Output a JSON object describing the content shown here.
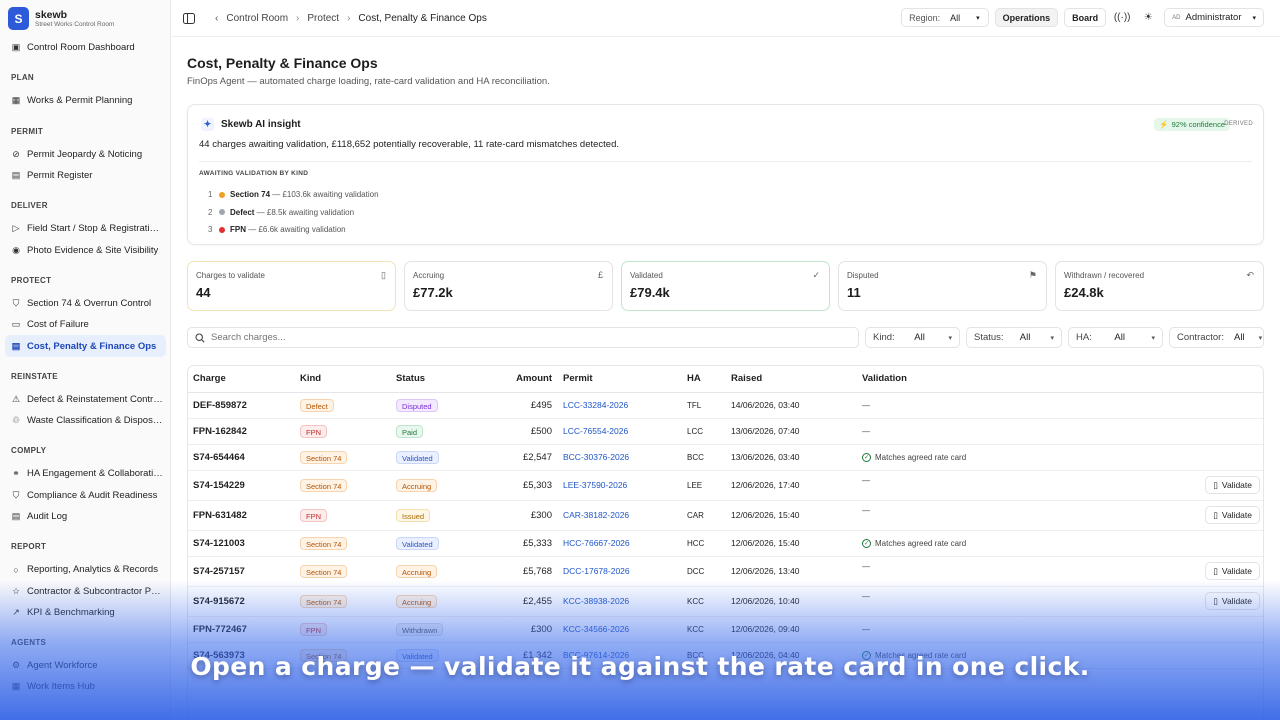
{
  "app": {
    "logo_letter": "S",
    "name": "skewb",
    "subtitle": "Street Works Control Room",
    "accent": "#2d5ad8"
  },
  "sidebar": {
    "top_item": {
      "label": "Control Room Dashboard",
      "icon": "dashboard-icon"
    },
    "sections": [
      {
        "title": "PLAN",
        "items": [
          {
            "label": "Works & Permit Planning",
            "icon": "calendar-icon"
          }
        ]
      },
      {
        "title": "PERMIT",
        "items": [
          {
            "label": "Permit Jeopardy & Noticing",
            "icon": "alert-icon"
          },
          {
            "label": "Permit Register",
            "icon": "register-icon"
          }
        ]
      },
      {
        "title": "DELIVER",
        "items": [
          {
            "label": "Field Start / Stop & Registrati…",
            "icon": "play-icon"
          },
          {
            "label": "Photo Evidence & Site Visibility",
            "icon": "camera-icon"
          }
        ]
      },
      {
        "title": "PROTECT",
        "items": [
          {
            "label": "Section 74 & Overrun Control",
            "icon": "shield-icon"
          },
          {
            "label": "Cost of Failure",
            "icon": "card-icon"
          },
          {
            "label": "Cost, Penalty & Finance Ops",
            "icon": "finance-icon",
            "active": true
          }
        ]
      },
      {
        "title": "REINSTATE",
        "items": [
          {
            "label": "Defect & Reinstatement Contr…",
            "icon": "defect-icon"
          },
          {
            "label": "Waste Classification & Dispos…",
            "icon": "waste-icon"
          }
        ]
      },
      {
        "title": "COMPLY",
        "items": [
          {
            "label": "HA Engagement & Collaborati…",
            "icon": "handshake-icon"
          },
          {
            "label": "Compliance & Audit Readiness",
            "icon": "check-shield-icon"
          },
          {
            "label": "Audit Log",
            "icon": "log-icon"
          }
        ]
      },
      {
        "title": "REPORT",
        "items": [
          {
            "label": "Reporting, Analytics & Records",
            "icon": "circle-icon"
          },
          {
            "label": "Contractor & Subcontractor P…",
            "icon": "star-icon"
          },
          {
            "label": "KPI & Benchmarking",
            "icon": "trend-icon"
          }
        ]
      },
      {
        "title": "AGENTS",
        "items": [
          {
            "label": "Agent Workforce",
            "icon": "agent-icon"
          },
          {
            "label": "Work Items Hub",
            "icon": "hub-icon"
          }
        ]
      }
    ]
  },
  "topbar": {
    "breadcrumbs": [
      "Control Room",
      "Protect",
      "Cost, Penalty & Finance Ops"
    ],
    "region_label": "Region:",
    "region_value": "All",
    "operations_label": "Operations",
    "board_label": "Board",
    "user_initials": "AD",
    "user_label": "Administrator"
  },
  "page": {
    "title": "Cost, Penalty & Finance Ops",
    "subtitle": "FinOps Agent — automated charge loading, rate-card validation and HA reconciliation."
  },
  "insight": {
    "title": "Skewb AI insight",
    "confidence": "92% confidence",
    "derived": "DERIVED",
    "summary": "44 charges awaiting validation, £118,652 potentially recoverable, 11 rate-card mismatches detected.",
    "kicker": "AWAITING VALIDATION BY KIND",
    "items": [
      {
        "num": "1",
        "kind": "Section 74",
        "text": " — £103.6k awaiting validation",
        "color": "#f0a020"
      },
      {
        "num": "2",
        "kind": "Defect",
        "text": " — £8.5k awaiting validation",
        "color": "#a0a6b0"
      },
      {
        "num": "3",
        "kind": "FPN",
        "text": " — £6.6k awaiting validation",
        "color": "#e03030"
      }
    ]
  },
  "kpis": [
    {
      "label": "Charges to validate",
      "value": "44",
      "icon": "file-icon",
      "border": "#f1e2b8"
    },
    {
      "label": "Accruing",
      "value": "£77.2k",
      "icon": "pound-icon",
      "border": "#e3e3e6"
    },
    {
      "label": "Validated",
      "value": "£79.4k",
      "icon": "check-circle-icon",
      "border": "#bfe6cd"
    },
    {
      "label": "Disputed",
      "value": "11",
      "icon": "flag-icon",
      "border": "#e3e3e6"
    },
    {
      "label": "Withdrawn / recovered",
      "value": "£24.8k",
      "icon": "undo-icon",
      "border": "#e3e3e6"
    }
  ],
  "filters": {
    "search_placeholder": "Search charges...",
    "kind_label": "Kind:",
    "kind_value": "All",
    "status_label": "Status:",
    "status_value": "All",
    "ha_label": "HA:",
    "ha_value": "All",
    "contractor_label": "Contractor:",
    "contractor_value": "All"
  },
  "table": {
    "columns": [
      "Charge",
      "Kind",
      "Status",
      "Amount",
      "Permit",
      "HA",
      "Raised",
      "Validation"
    ],
    "validate_label": "Validate",
    "rows": [
      {
        "charge": "DEF-859872",
        "kind": "Defect",
        "status": "Disputed",
        "amount": "£495",
        "permit": "LCC-33284-2026",
        "ha": "TFL",
        "raised": "14/06/2026, 03:40",
        "validation": "—",
        "action": false
      },
      {
        "charge": "FPN-162842",
        "kind": "FPN",
        "status": "Paid",
        "amount": "£500",
        "permit": "LCC-76554-2026",
        "ha": "LCC",
        "raised": "13/06/2026, 07:40",
        "validation": "—",
        "action": false
      },
      {
        "charge": "S74-654464",
        "kind": "Section 74",
        "status": "Validated",
        "amount": "£2,547",
        "permit": "BCC-30376-2026",
        "ha": "BCC",
        "raised": "13/06/2026, 03:40",
        "validation": "Matches agreed rate card",
        "ok": true,
        "action": false
      },
      {
        "charge": "S74-154229",
        "kind": "Section 74",
        "status": "Accruing",
        "amount": "£5,303",
        "permit": "LEE-37590-2026",
        "ha": "LEE",
        "raised": "12/06/2026, 17:40",
        "validation": "—",
        "action": true
      },
      {
        "charge": "FPN-631482",
        "kind": "FPN",
        "status": "Issued",
        "amount": "£300",
        "permit": "CAR-38182-2026",
        "ha": "CAR",
        "raised": "12/06/2026, 15:40",
        "validation": "—",
        "action": true
      },
      {
        "charge": "S74-121003",
        "kind": "Section 74",
        "status": "Validated",
        "amount": "£5,333",
        "permit": "HCC-76667-2026",
        "ha": "HCC",
        "raised": "12/06/2026, 15:40",
        "validation": "Matches agreed rate card",
        "ok": true,
        "action": false
      },
      {
        "charge": "S74-257157",
        "kind": "Section 74",
        "status": "Accruing",
        "amount": "£5,768",
        "permit": "DCC-17678-2026",
        "ha": "DCC",
        "raised": "12/06/2026, 13:40",
        "validation": "—",
        "action": true
      },
      {
        "charge": "S74-915672",
        "kind": "Section 74",
        "status": "Accruing",
        "amount": "£2,455",
        "permit": "KCC-38938-2026",
        "ha": "KCC",
        "raised": "12/06/2026, 10:40",
        "validation": "—",
        "action": true
      },
      {
        "charge": "FPN-772467",
        "kind": "FPN",
        "status": "Withdrawn",
        "amount": "£300",
        "permit": "KCC-34566-2026",
        "ha": "KCC",
        "raised": "12/06/2026, 09:40",
        "validation": "—",
        "action": false
      },
      {
        "charge": "S74-563973",
        "kind": "Section 74",
        "status": "Validated",
        "amount": "£1,342",
        "permit": "BCC-97614-2026",
        "ha": "BCC",
        "raised": "12/06/2026, 04:40",
        "validation": "Matches agreed rate card",
        "ok": true,
        "action": false
      }
    ]
  },
  "caption": "Open a charge — validate it against the rate card in one click."
}
